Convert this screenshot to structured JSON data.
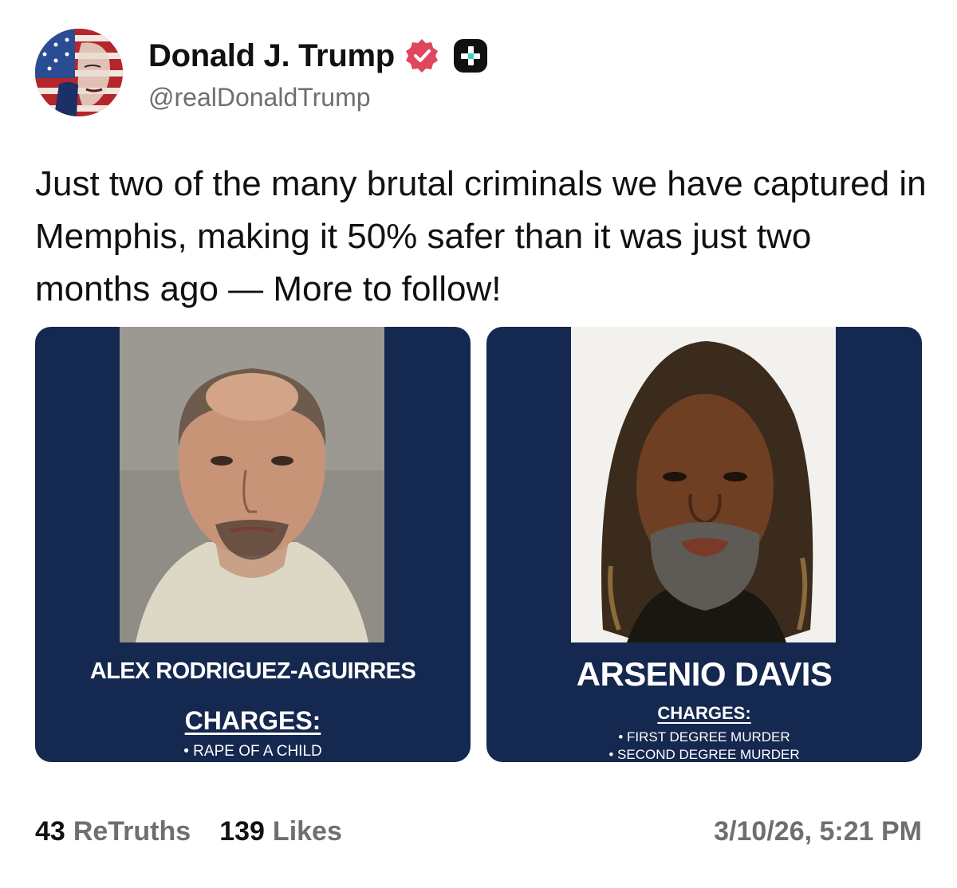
{
  "author": {
    "display_name": "Donald J. Trump",
    "handle": "@realDonaldTrump",
    "verified_badge_color": "#e0475f",
    "avatar_icon": "flag-portrait-avatar"
  },
  "post": {
    "text": "Just two of the many brutal criminals we have captured in Memphis, making it 50% safer than it was just two months ago — More to follow!"
  },
  "media": [
    {
      "name": "ALEX RODRIGUEZ-AGUIRRES",
      "charges_label": "CHARGES:",
      "charges": [
        "• RAPE OF A CHILD"
      ]
    },
    {
      "name": "ARSENIO DAVIS",
      "charges_label": "CHARGES:",
      "charges": [
        "• FIRST DEGREE MURDER",
        "• SECOND DEGREE MURDER"
      ]
    }
  ],
  "stats": {
    "retruths_count": "43",
    "retruths_label": "ReTruths",
    "likes_count": "139",
    "likes_label": "Likes"
  },
  "timestamp": "3/10/26, 5:21 PM",
  "colors": {
    "card_background": "#15284f",
    "text_primary": "#111111",
    "text_secondary": "#6e6e73"
  }
}
